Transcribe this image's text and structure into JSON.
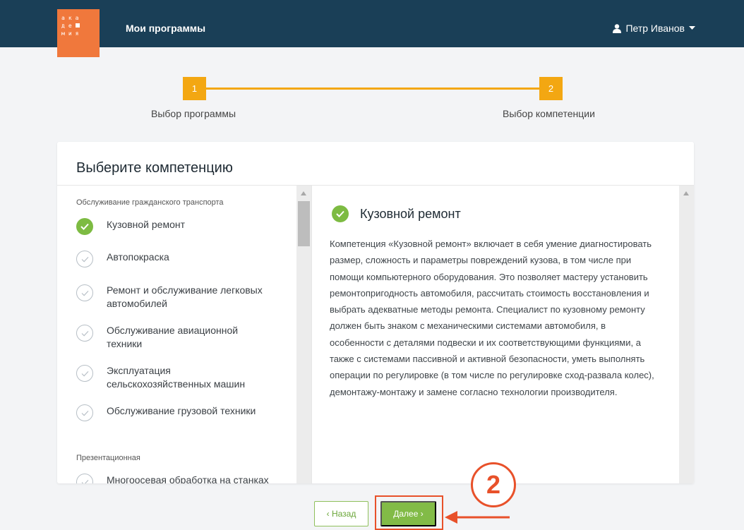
{
  "header": {
    "logo_rows": [
      [
        "а",
        "к",
        "а"
      ],
      [
        "д",
        "е",
        ""
      ],
      [
        "м",
        "и",
        "я"
      ]
    ],
    "title": "Мои программы",
    "user_name": "Петр Иванов"
  },
  "stepper": {
    "steps": [
      {
        "number": "1",
        "label": "Выбор программы"
      },
      {
        "number": "2",
        "label": "Выбор компетенции"
      }
    ]
  },
  "card": {
    "title": "Выберите компетенцию",
    "groups": [
      {
        "title": "Обслуживание гражданского транспорта",
        "items": [
          {
            "label": "Кузовной ремонт",
            "selected": true
          },
          {
            "label": "Автопокраска",
            "selected": false
          },
          {
            "label": "Ремонт и обслуживание легковых автомобилей",
            "selected": false
          },
          {
            "label": "Обслуживание авиационной техники",
            "selected": false
          },
          {
            "label": "Эксплуатация сельскохозяйственных машин",
            "selected": false
          },
          {
            "label": "Обслуживание грузовой техники",
            "selected": false
          }
        ]
      },
      {
        "title": "Презентационная",
        "items": [
          {
            "label": "Многоосевая обработка на станках",
            "selected": false
          }
        ]
      }
    ],
    "detail": {
      "title": "Кузовной ремонт",
      "text": "Компетенция «Кузовной ремонт» включает в себя умение диагностировать размер, сложность и параметры повреждений кузова, в том числе при помощи компьютерного оборудования. Это позволяет мастеру установить ремонтопригодность автомобиля, рассчитать стоимость восстановления и выбрать адекватные методы ремонта. Специалист по кузовному ремонту должен быть знаком с механическими системами автомобиля, в особенности с деталями подвески и их соответствующими функциями, а также с системами пассивной и активной безопасности, уметь выполнять операции по регулировке (в том числе по регулировке сход-развала колес), демонтажу-монтажу и замене согласно технологии производителя."
    }
  },
  "actions": {
    "back_label": "‹ Назад",
    "next_label": "Далее ›"
  },
  "annotation": {
    "badge": "2"
  },
  "colors": {
    "header_bg": "#1a3f57",
    "logo_bg": "#f0783c",
    "step_accent": "#f3a712",
    "success": "#7dbb42",
    "annotation": "#e8512a"
  }
}
